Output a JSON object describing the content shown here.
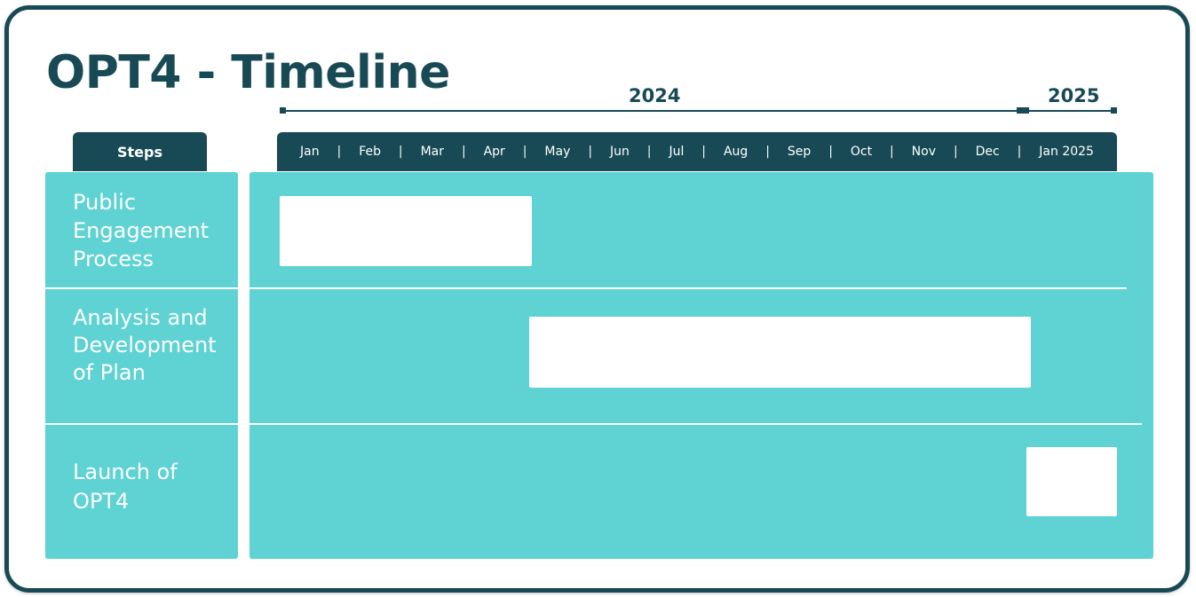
{
  "title": "OPT4 - Timeline",
  "years": {
    "y2024": "2024",
    "y2025": "2025"
  },
  "headers": {
    "steps": "Steps"
  },
  "months": [
    "Jan",
    "Feb",
    "Mar",
    "Apr",
    "May",
    "Jun",
    "Jul",
    "Aug",
    "Sep",
    "Oct",
    "Nov",
    "Dec",
    "Jan 2025"
  ],
  "steps": [
    {
      "label_lines": [
        "Public",
        "Engagement",
        "Process"
      ],
      "start": "Jan 2024",
      "end": "Apr 2024"
    },
    {
      "label_lines": [
        "Analysis and",
        "Development",
        "of Plan"
      ],
      "start": "May 2024",
      "end": "Dec 2024"
    },
    {
      "label_lines": [
        "Launch of",
        "OPT4"
      ],
      "start": "Jan 2025",
      "end": "Jan 2025"
    }
  ],
  "colors": {
    "dark": "#184a55",
    "teal": "#5fd2d4",
    "bar": "#ffffff"
  }
}
